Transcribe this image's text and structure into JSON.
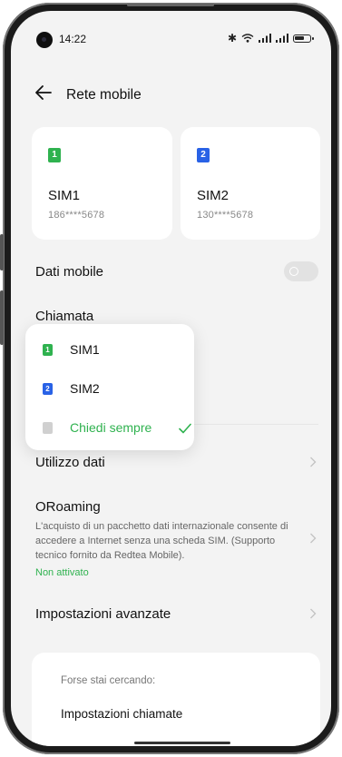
{
  "status_bar": {
    "time": "14:22",
    "icons": [
      "bluetooth-icon",
      "wifi-icon",
      "signal-icon",
      "signal-icon",
      "battery-icon"
    ]
  },
  "header": {
    "title": "Rete mobile"
  },
  "sims": [
    {
      "badge": "1",
      "name": "SIM1",
      "number": "186****5678",
      "color": "#2fb24f"
    },
    {
      "badge": "2",
      "name": "SIM2",
      "number": "130****5678",
      "color": "#2962e6"
    }
  ],
  "settings": {
    "mobile_data": {
      "label": "Dati mobile",
      "enabled": false
    },
    "call": {
      "label": "Chiamata"
    },
    "data_usage": {
      "label": "Utilizzo dati"
    },
    "oroaming": {
      "label": "ORoaming",
      "description": "L'acquisto di un pacchetto dati internazionale consente di accedere a Internet senza una scheda SIM. (Supporto tecnico fornito da Redtea Mobile).",
      "status": "Non attivato"
    },
    "advanced": {
      "label": "Impostazioni avanzate"
    }
  },
  "call_popup": {
    "items": [
      {
        "badge": "1",
        "label": "SIM1",
        "color": "#2fb24f",
        "selected": false
      },
      {
        "badge": "2",
        "label": "SIM2",
        "color": "#2962e6",
        "selected": false
      },
      {
        "badge": "",
        "label": "Chiedi sempre",
        "color": "#d0d0d0",
        "selected": true
      }
    ]
  },
  "search_suggestions": {
    "hint": "Forse stai cercando:",
    "link": "Impostazioni chiamate"
  },
  "colors": {
    "accent": "#2fb24f",
    "sim2": "#2962e6",
    "background": "#f3f3f3"
  }
}
